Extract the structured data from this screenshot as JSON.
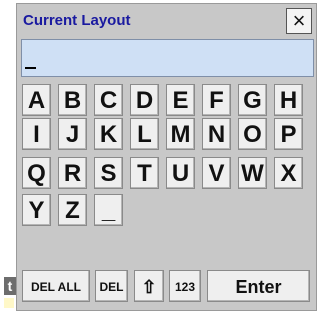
{
  "left_edge": {
    "glyph": "t"
  },
  "dialog": {
    "title": "Current Layout",
    "close_label": "×",
    "input_value": ""
  },
  "keyboard": {
    "row1": [
      "A",
      "B",
      "C",
      "D",
      "E",
      "F",
      "G",
      "H"
    ],
    "row2": [
      "I",
      "J",
      "K",
      "L",
      "M",
      "N",
      "O",
      "P"
    ],
    "row3": [
      "Q",
      "R",
      "S",
      "T",
      "U",
      "V",
      "W",
      "X"
    ],
    "row4": [
      "Y",
      "Z",
      "_"
    ],
    "function_keys": {
      "del_all": "DEL ALL",
      "del": "DEL",
      "shift": "⇧",
      "numbers": "123",
      "enter": "Enter"
    }
  }
}
